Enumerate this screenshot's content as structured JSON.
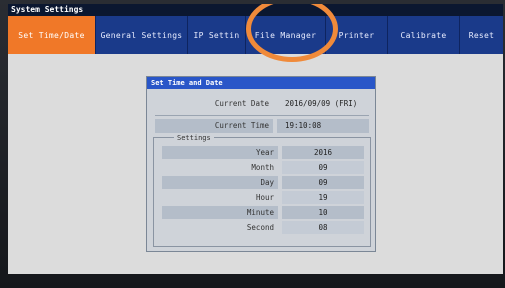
{
  "window": {
    "title": "System Settings"
  },
  "tabs": [
    {
      "label": "Set Time/Date",
      "active": true
    },
    {
      "label": "General Settings",
      "active": false
    },
    {
      "label": "IP Settin",
      "active": false
    },
    {
      "label": "File Manager",
      "active": false
    },
    {
      "label": "Printer",
      "active": false
    },
    {
      "label": "Calibrate",
      "active": false
    },
    {
      "label": "Reset",
      "active": false
    }
  ],
  "panel": {
    "title": "Set Time and Date",
    "current_date_label": "Current Date",
    "current_date_value": "2016/09/09 (FRI)",
    "current_time_label": "Current Time",
    "current_time_value": "19:10:08",
    "settings_legend": "Settings",
    "fields": [
      {
        "label": "Year",
        "value": "2016"
      },
      {
        "label": "Month",
        "value": "09"
      },
      {
        "label": "Day",
        "value": "09"
      },
      {
        "label": "Hour",
        "value": "19"
      },
      {
        "label": "Minute",
        "value": "10"
      },
      {
        "label": "Second",
        "value": "08"
      }
    ]
  },
  "colors": {
    "active_tab": "#f07828",
    "tab_bar": "#1a3a8a",
    "panel_title": "#2956c8",
    "annotation": "#f08a3a"
  }
}
